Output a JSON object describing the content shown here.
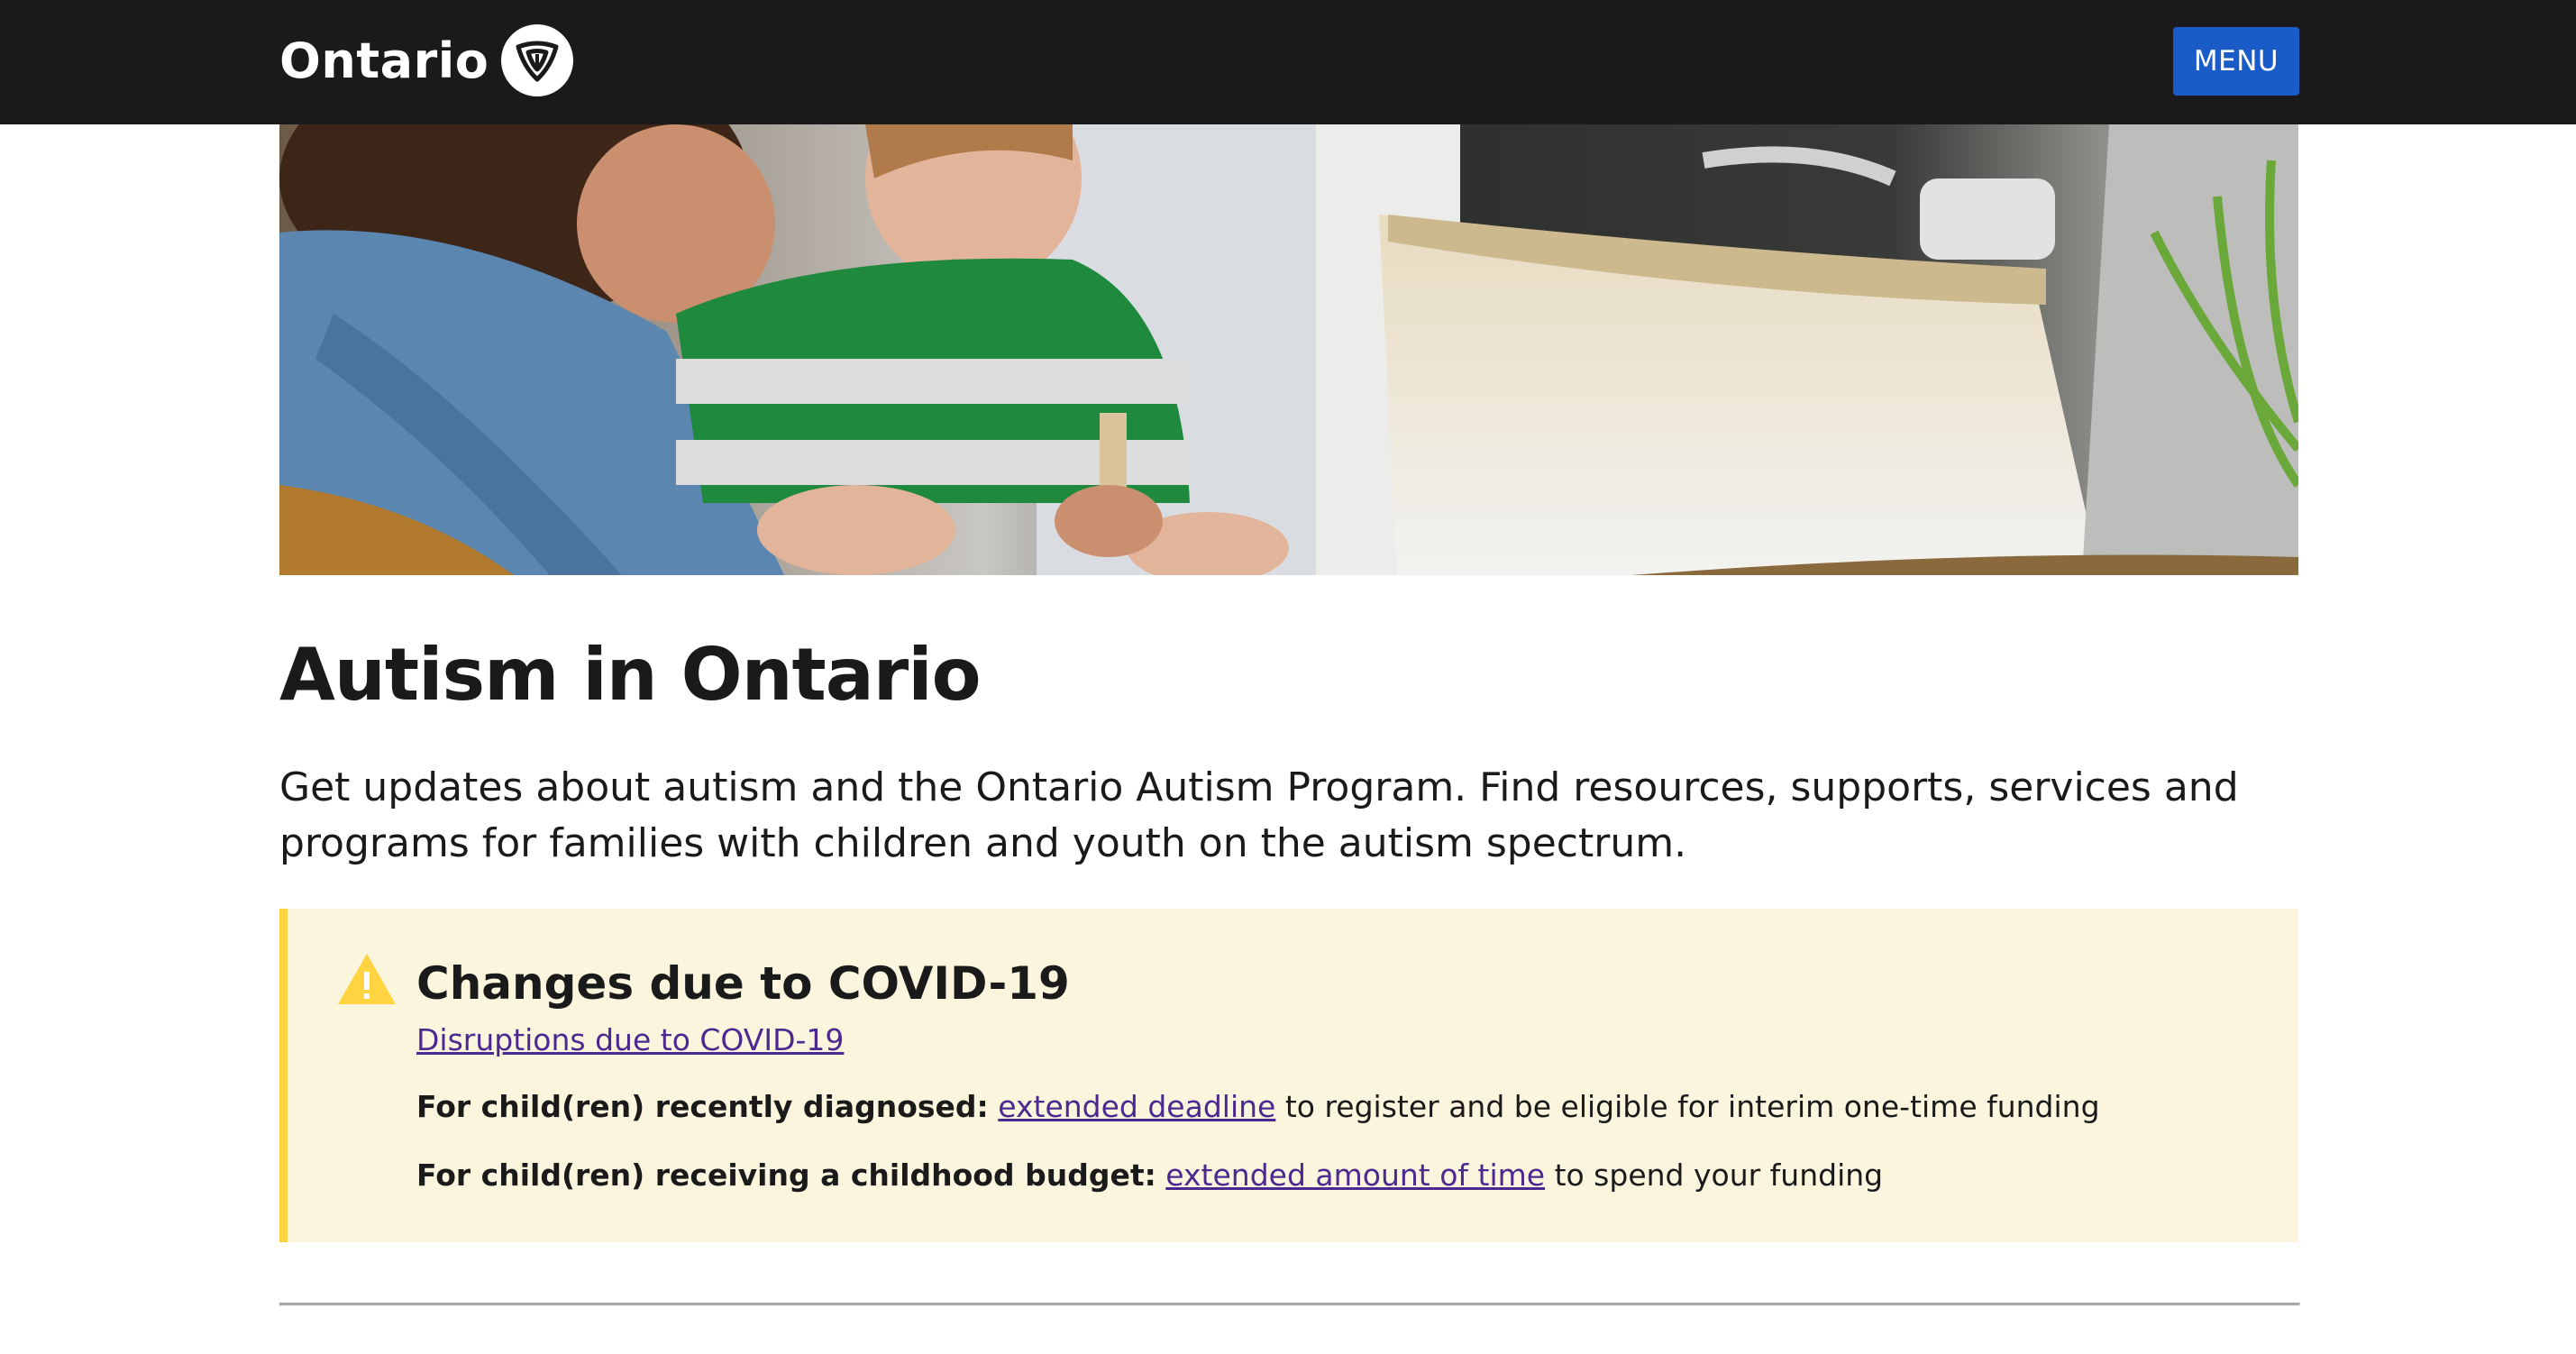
{
  "header": {
    "logo_text": "Ontario",
    "logo_icon": "trillium-icon",
    "menu_label": "MENU",
    "background": "#1a1a1a",
    "menu_color": "#1a5cc7"
  },
  "hero": {
    "image": "parent-and-child-photo"
  },
  "main": {
    "title": "Autism in Ontario",
    "intro": "Get updates about autism and the Ontario Autism Program. Find resources, supports, services and programs for families with children and youth on the autism spectrum."
  },
  "alert": {
    "icon": "warning-icon",
    "heading": "Changes due to COVID-19",
    "link_text": "Disruptions due to COVID-19",
    "item1": {
      "label": "For child(ren) recently diagnosed:",
      "link": "extended deadline",
      "rest": " to register and be eligible for interim one-time funding"
    },
    "item2": {
      "label": "For child(ren) receiving a childhood budget:",
      "link": "extended amount of time",
      "rest": " to spend your funding"
    },
    "background": "#fcf5dd",
    "accent": "#ffd440",
    "link_color": "#4b2991"
  }
}
